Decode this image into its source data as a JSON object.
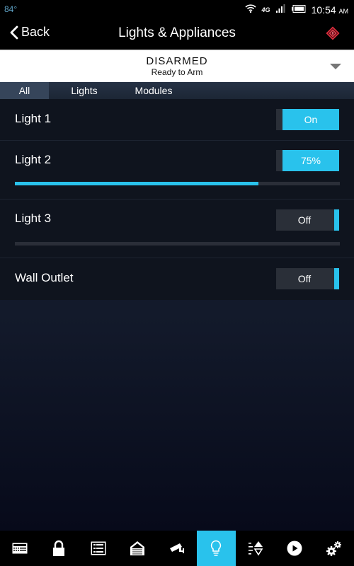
{
  "status_bar": {
    "temperature": "84°",
    "network": "4G LTE",
    "time": "10:54",
    "ampm": "AM"
  },
  "header": {
    "back_label": "Back",
    "title": "Lights & Appliances",
    "alarm_icon": "alarm-diamond-icon"
  },
  "arm_status": {
    "state": "DISARMED",
    "detail": "Ready to Arm"
  },
  "tabs": [
    {
      "label": "All",
      "active": true
    },
    {
      "label": "Lights",
      "active": false
    },
    {
      "label": "Modules",
      "active": false
    }
  ],
  "devices": [
    {
      "name": "Light 1",
      "toggle_label": "On",
      "state": "on"
    },
    {
      "name": "Light 2",
      "toggle_label": "75%",
      "state": "on",
      "dim_level_percent": 75
    },
    {
      "name": "Light 3",
      "toggle_label": "Off",
      "state": "off",
      "dim_level_percent": 0
    },
    {
      "name": "Wall Outlet",
      "toggle_label": "Off",
      "state": "off"
    }
  ],
  "bottom_nav": [
    {
      "icon": "keypad-icon",
      "active": false
    },
    {
      "icon": "lock-icon",
      "active": false
    },
    {
      "icon": "list-icon",
      "active": false
    },
    {
      "icon": "garage-icon",
      "active": false
    },
    {
      "icon": "camera-icon",
      "active": false
    },
    {
      "icon": "lightbulb-icon",
      "active": true
    },
    {
      "icon": "thermostat-icon",
      "active": false
    },
    {
      "icon": "play-icon",
      "active": false
    },
    {
      "icon": "settings-gears-icon",
      "active": false
    }
  ],
  "colors": {
    "accent": "#29c2ec",
    "alarm": "#d42a3a"
  }
}
